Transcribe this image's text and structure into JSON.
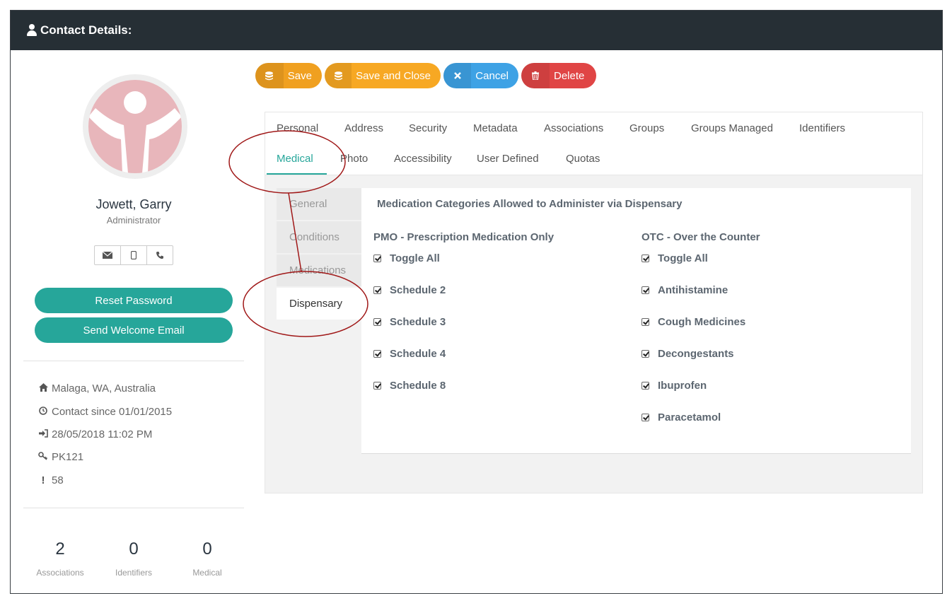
{
  "window": {
    "title": "Contact Details:"
  },
  "profile": {
    "name": "Jowett, Garry",
    "role": "Administrator",
    "buttons": {
      "reset_password": "Reset Password",
      "send_welcome": "Send Welcome Email"
    },
    "info": {
      "location": "Malaga, WA, Australia",
      "contact_since": "Contact since 01/01/2015",
      "last_login": "28/05/2018 11:02 PM",
      "key": "PK121",
      "alert": "58"
    },
    "stats": [
      {
        "value": "2",
        "label": "Associations"
      },
      {
        "value": "0",
        "label": "Identifiers"
      },
      {
        "value": "0",
        "label": "Medical"
      }
    ]
  },
  "toolbar": {
    "save": "Save",
    "save_close": "Save and Close",
    "cancel": "Cancel",
    "delete": "Delete",
    "colors": {
      "save": "#f0a020",
      "save_close": "#f7a823",
      "cancel": "#3ea2e5",
      "delete": "#e04545"
    }
  },
  "tabs": {
    "row1": [
      "Personal",
      "Address",
      "Security",
      "Metadata",
      "Associations",
      "Groups",
      "Groups Managed",
      "Identifiers"
    ],
    "row2": [
      "Medical",
      "Photo",
      "Accessibility",
      "User Defined",
      "Quotas"
    ],
    "active": "Medical"
  },
  "subnav": {
    "items": [
      "General",
      "Conditions",
      "Medications",
      "Dispensary"
    ],
    "active": "Dispensary"
  },
  "dispensary": {
    "title": "Medication Categories Allowed to Administer via Dispensary",
    "pmo": {
      "heading": "PMO - Prescription Medication Only",
      "items": [
        "Toggle All",
        "Schedule 2",
        "Schedule 3",
        "Schedule 4",
        "Schedule 8"
      ]
    },
    "otc": {
      "heading": "OTC - Over the Counter",
      "items": [
        "Toggle All",
        "Antihistamine",
        "Cough Medicines",
        "Decongestants",
        "Ibuprofen",
        "Paracetamol"
      ]
    }
  },
  "accent_color": "#26a69a",
  "titlebar_color": "#262f35"
}
